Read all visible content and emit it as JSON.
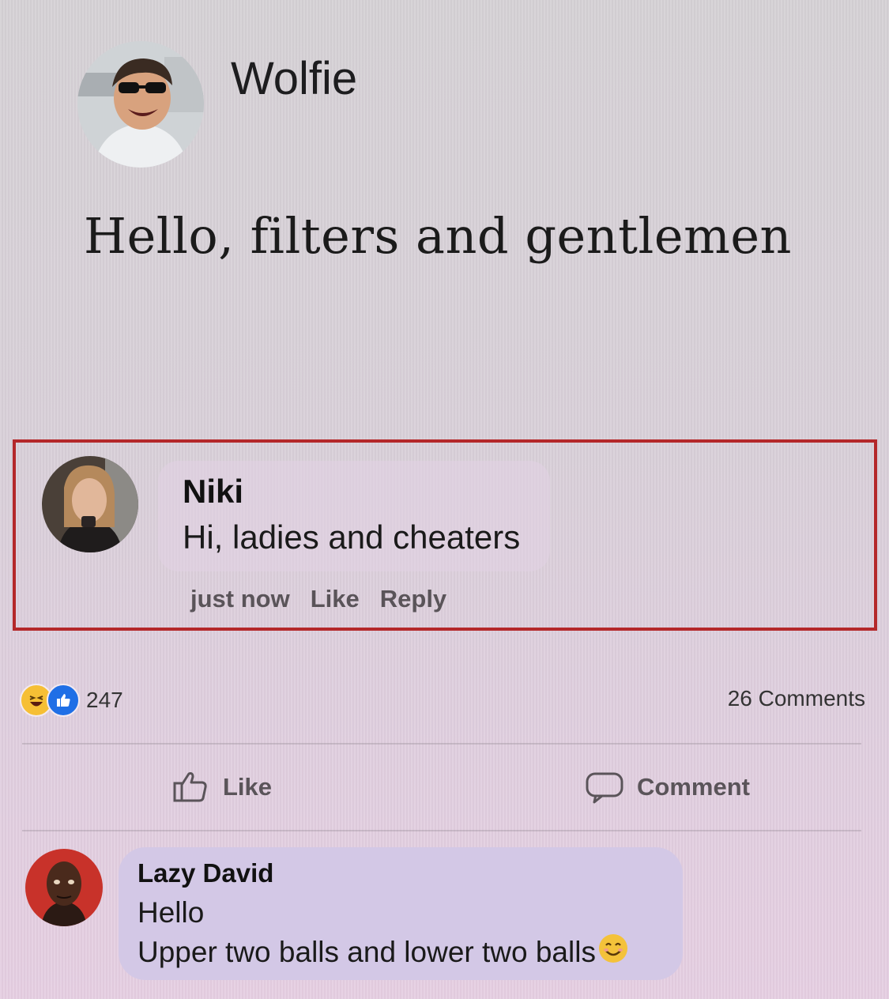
{
  "post": {
    "author": "Wolfie",
    "text": "Hello, filters and gentlemen"
  },
  "highlighted_comment": {
    "author": "Niki",
    "text": "Hi, ladies and cheaters",
    "time": "just now",
    "like_label": "Like",
    "reply_label": "Reply",
    "highlight_color": "#b4282a"
  },
  "stats": {
    "reaction_count": "247",
    "reaction_icons": [
      "haha-icon",
      "like-icon"
    ],
    "comments_count": "26 Comments"
  },
  "actions": {
    "like_label": "Like",
    "comment_label": "Comment"
  },
  "second_comment": {
    "author": "Lazy David",
    "line1": "Hello",
    "line2": "Upper two balls and lower two balls",
    "emoji": "smiling-face-icon"
  }
}
